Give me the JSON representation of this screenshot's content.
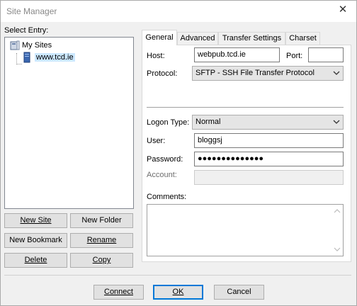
{
  "window": {
    "title": "Site Manager",
    "close_glyph": "✕"
  },
  "left": {
    "select_entry_label": "Select Entry:",
    "tree": {
      "root_label": "My Sites",
      "site_label": "www.tcd.ie"
    },
    "buttons": {
      "new_site": "New Site",
      "new_folder": "New Folder",
      "new_bookmark": "New Bookmark",
      "rename": "Rename",
      "delete": "Delete",
      "copy": "Copy"
    }
  },
  "tabs": [
    {
      "label": "General",
      "active": true
    },
    {
      "label": "Advanced",
      "active": false
    },
    {
      "label": "Transfer Settings",
      "active": false
    },
    {
      "label": "Charset",
      "active": false
    }
  ],
  "general": {
    "host_label": "Host:",
    "host_value": "webpub.tcd.ie",
    "port_label": "Port:",
    "port_value": "",
    "protocol_label": "Protocol:",
    "protocol_value": "SFTP - SSH File Transfer Protocol",
    "logon_type_label": "Logon Type:",
    "logon_type_value": "Normal",
    "user_label": "User:",
    "user_value": "bloggsj",
    "password_label": "Password:",
    "password_value": "●●●●●●●●●●●●●●",
    "account_label": "Account:",
    "account_value": "",
    "comments_label": "Comments:",
    "comments_value": ""
  },
  "footer": {
    "connect": "Connect",
    "ok": "OK",
    "cancel": "Cancel"
  },
  "colors": {
    "accent": "#0078d7",
    "selection": "#cce8ff"
  }
}
